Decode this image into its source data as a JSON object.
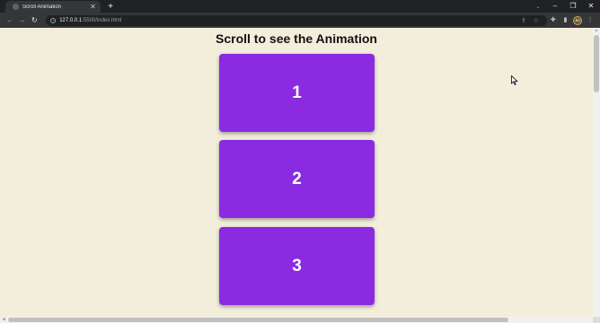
{
  "browser": {
    "tab": {
      "title": "Scroll Animation",
      "close_glyph": "✕"
    },
    "new_tab_glyph": "+",
    "window_controls": {
      "minimize": "–",
      "restore": "❐",
      "close": "✕",
      "tab_search": "⌄"
    },
    "nav": {
      "back": "←",
      "forward": "→",
      "reload": "↻"
    },
    "address": {
      "host": "127.0.0.1",
      "path": ":5500/index.html",
      "info_glyph": "i"
    },
    "omnibox_icons": {
      "share": "⇪",
      "bookmark": "☆"
    },
    "toolbar_icons": {
      "extensions": "✚",
      "sidepanel": "▮",
      "profile": "BS",
      "menu": "⋮"
    }
  },
  "page": {
    "title": "Scroll to see the Animation",
    "cards": [
      {
        "label": "1"
      },
      {
        "label": "2"
      },
      {
        "label": "3"
      }
    ],
    "card_color": "#8a2be2",
    "background_color": "#f3eedb"
  },
  "scrollbars": {
    "up_arrow": "▲",
    "left_arrow": "◀"
  }
}
